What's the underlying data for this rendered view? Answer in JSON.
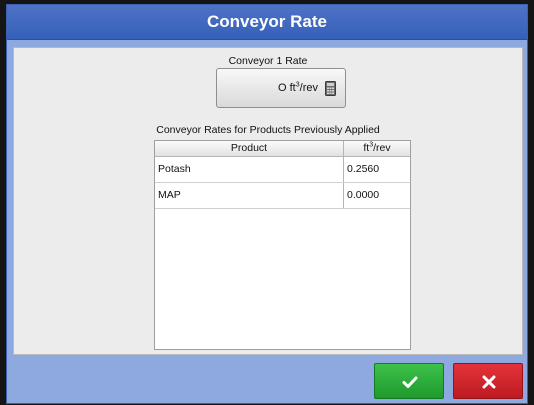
{
  "dialog": {
    "title": "Conveyor Rate"
  },
  "conveyor_rate": {
    "label": "Conveyor 1 Rate",
    "value": "O",
    "unit_prefix": "ft",
    "unit_exp": "3",
    "unit_suffix": "/rev",
    "icon": "calculator-icon"
  },
  "history": {
    "label": "Conveyor Rates for Products Previously Applied",
    "columns": {
      "product": "Product",
      "rate_prefix": "ft",
      "rate_exp": "3",
      "rate_suffix": "/rev"
    },
    "rows": [
      {
        "product": "Potash",
        "rate": "0.2560"
      },
      {
        "product": "MAP",
        "rate": "0.0000"
      }
    ]
  },
  "actions": {
    "ok_icon": "checkmark-icon",
    "cancel_icon": "x-icon",
    "ok_color": "#2bb13b",
    "cancel_color": "#d8262d"
  }
}
